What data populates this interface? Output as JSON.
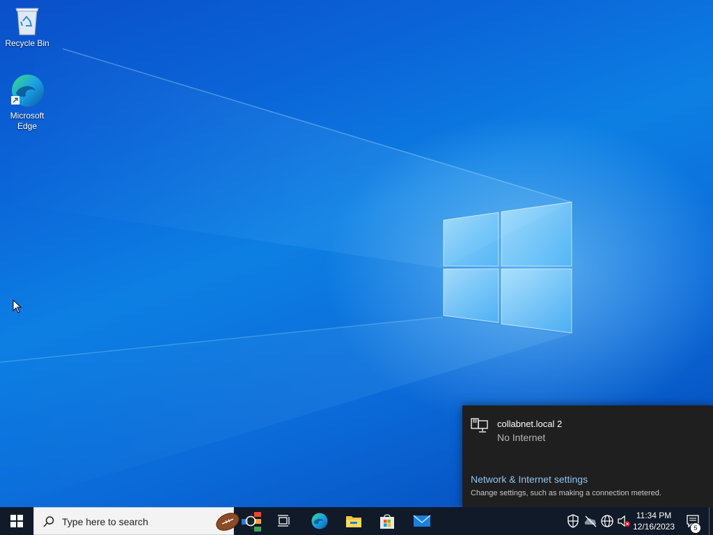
{
  "desktop": {
    "icons": [
      {
        "label": "Recycle Bin",
        "icon": "recycle-bin-icon"
      },
      {
        "label": "Microsoft Edge",
        "icon": "edge-icon"
      }
    ]
  },
  "network_flyout": {
    "network_name": "collabnet.local 2",
    "network_status": "No Internet",
    "settings_link": "Network & Internet settings",
    "settings_desc": "Change settings, such as making a connection metered."
  },
  "taskbar": {
    "search_placeholder": "Type here to search",
    "pinned": [
      "cortana-icon",
      "task-view-icon",
      "edge-icon",
      "file-explorer-icon",
      "store-icon",
      "mail-icon"
    ],
    "clock_time": "11:34 PM",
    "clock_date": "12/16/2023",
    "notification_count": "5"
  },
  "colors": {
    "accent_link": "#8dc5f5",
    "taskbar_bg": "#101a28",
    "flyout_bg": "#1f1f1f"
  }
}
